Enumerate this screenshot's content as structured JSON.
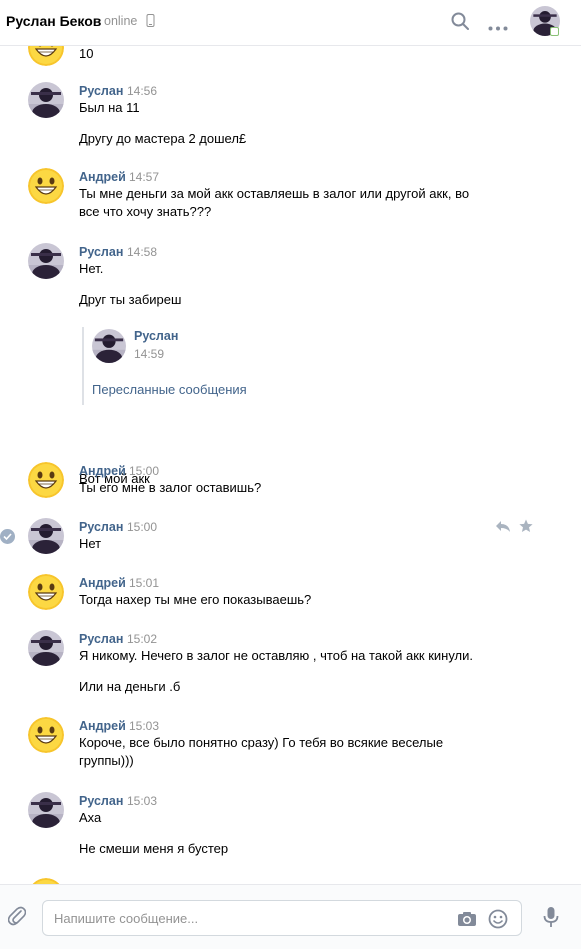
{
  "header": {
    "name": "Руслан Беков",
    "status": "online"
  },
  "partial_top_text": "10",
  "messages": [
    {
      "author": "Руслан",
      "time": "14:56",
      "lines": [
        "Был на 11",
        "",
        "Другу до мастера 2 дошел£"
      ]
    },
    {
      "author": "Андрей",
      "time": "14:57",
      "lines": [
        "Ты мне деньги за мой акк оставляешь в залог или другой акк, во",
        "все что хочу знать???"
      ]
    },
    {
      "author": "Руслан",
      "time": "14:58",
      "lines": [
        "Нет.",
        "",
        "Друг ты забиреш"
      ],
      "after": "Вот мой акк"
    },
    {
      "author": "Андрей",
      "time": "15:00",
      "lines": [
        "Ты его мне в залог оставишь?"
      ]
    },
    {
      "author": "Руслан",
      "time": "15:00",
      "lines": [
        "Нет"
      ]
    },
    {
      "author": "Андрей",
      "time": "15:01",
      "lines": [
        "Тогда нахер ты мне его показываешь?"
      ]
    },
    {
      "author": "Руслан",
      "time": "15:02",
      "lines": [
        "Я никому. Нечего в залог не оставляю , чтоб на такой акк кинули.",
        "",
        "Или на деньги .б"
      ]
    },
    {
      "author": "Андрей",
      "time": "15:03",
      "lines": [
        "Короче, все было понятно сразу) Го тебя во всякие веселые",
        "группы)))"
      ]
    },
    {
      "author": "Руслан",
      "time": "15:03",
      "lines": [
        "Аха",
        "",
        "Не смеши меня я бустер"
      ]
    }
  ],
  "forwarded": {
    "author": "Руслан",
    "time": "14:59",
    "link": "Пересланные сообщения"
  },
  "composer": {
    "placeholder": "Напишите сообщение..."
  },
  "colors": {
    "author": "#42648b",
    "time": "#939393",
    "divider": "#e7e8ec"
  }
}
